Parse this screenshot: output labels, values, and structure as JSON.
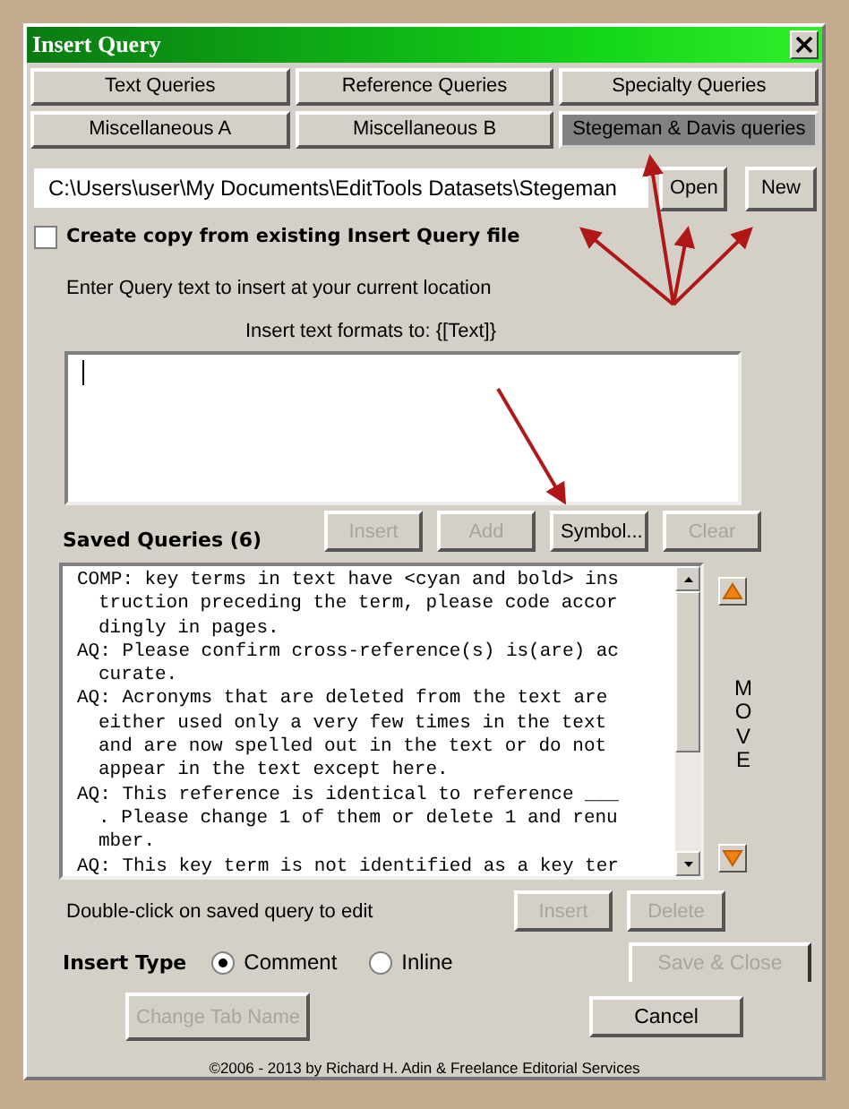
{
  "window": {
    "title": "Insert Query"
  },
  "tab_rows": [
    [
      {
        "label": "Text Queries",
        "selected": false
      },
      {
        "label": "Reference Queries",
        "selected": false
      },
      {
        "label": "Specialty Queries",
        "selected": false
      }
    ],
    [
      {
        "label": "Miscellaneous A",
        "selected": false
      },
      {
        "label": "Miscellaneous B",
        "selected": false
      },
      {
        "label": "Stegeman & Davis queries",
        "selected": true
      }
    ]
  ],
  "file_path": {
    "value": "C:\\Users\\user\\My Documents\\EditTools Datasets\\Stegeman"
  },
  "file_buttons": [
    {
      "label": "Open",
      "disabled": false
    },
    {
      "label": "New",
      "disabled": false
    }
  ],
  "copy_checkbox": {
    "label": "Create copy from existing Insert Query file",
    "checked": false
  },
  "instruction": "Enter Query text to insert at your current location",
  "format_note": "Insert text formats to: {[Text]}",
  "query_buttons": [
    {
      "label": "Insert",
      "disabled": true
    },
    {
      "label": "Add",
      "disabled": true
    },
    {
      "label": "Symbol...",
      "disabled": false
    },
    {
      "label": "Clear",
      "disabled": true
    }
  ],
  "saved_queries": {
    "title": "Saved Queries (6)",
    "move_label": "MOVE",
    "items": [
      {
        "lines": [
          "COMP: key terms in text have <cyan and bold> ins",
          "truction preceding the term, please code accor",
          "dingly in pages."
        ]
      },
      {
        "lines": [
          "AQ: Please confirm cross-reference(s) is(are) ac",
          "curate."
        ]
      },
      {
        "lines": [
          "AQ: Acronyms that are deleted from the text are",
          "either used only a very few times in the text",
          "and are now spelled out in the text or do not",
          "appear in the text except here."
        ]
      },
      {
        "lines": [
          "AQ: This reference is identical to reference ___",
          ". Please change 1 of them or delete 1 and renu",
          "mber."
        ]
      },
      {
        "lines": [
          "AQ: This key term is not identified as a key ter"
        ]
      }
    ]
  },
  "hint": "Double-click on saved query to edit",
  "list_buttons": [
    {
      "label": "Insert",
      "disabled": true
    },
    {
      "label": "Delete",
      "disabled": true
    }
  ],
  "insert_type": {
    "label": "Insert Type",
    "options": [
      {
        "label": "Comment",
        "selected": true
      },
      {
        "label": "Inline",
        "selected": false
      }
    ]
  },
  "save_button": {
    "label": "Save & Close",
    "disabled": true
  },
  "change_tab_button": {
    "label": "Change Tab Name",
    "disabled": true
  },
  "cancel_button": {
    "label": "Cancel",
    "disabled": false
  },
  "footer": "©2006 - 2013 by Richard H. Adin & Freelance Editorial Services"
}
